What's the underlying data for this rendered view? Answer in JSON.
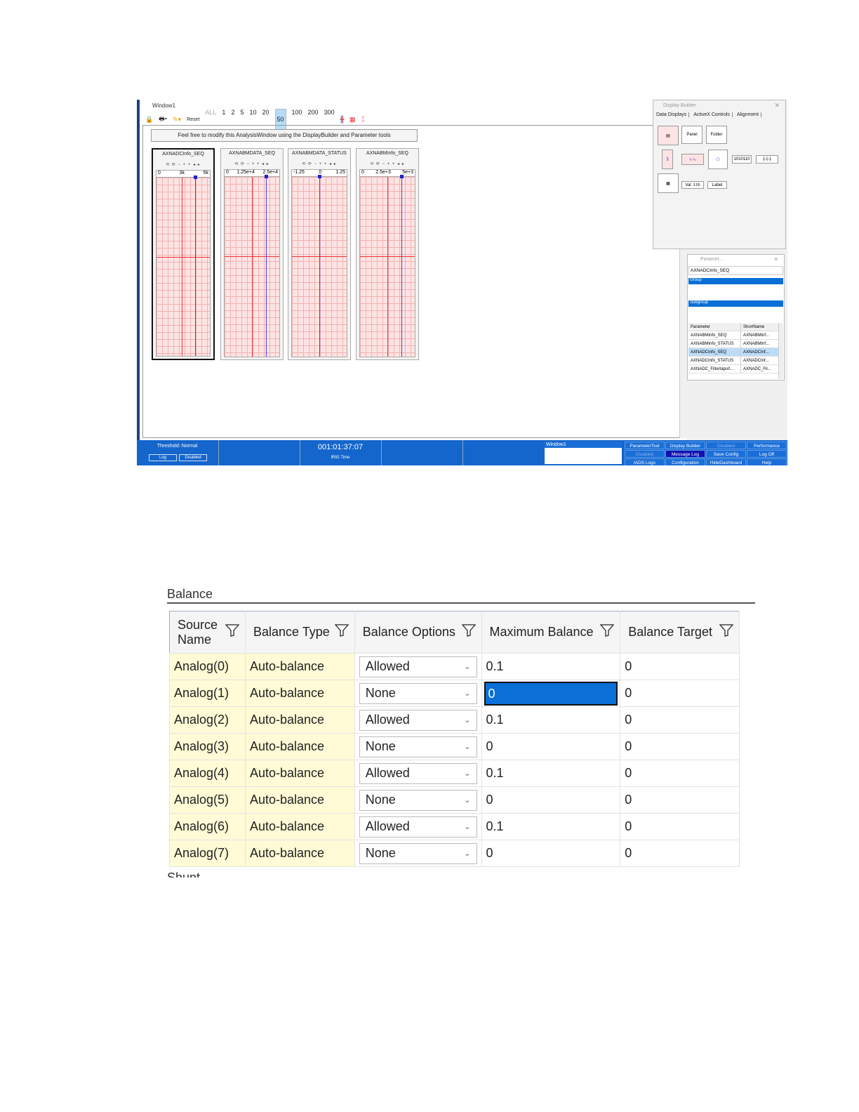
{
  "analysis_window": {
    "title": "Window1",
    "toolbar": {
      "reset": "Reset",
      "ranges": [
        "ALL",
        "1",
        "2",
        "5",
        "10",
        "20",
        "50",
        "100",
        "200",
        "300"
      ],
      "selected_range": "50"
    },
    "banner": "Feel free to modify this AnalysisWindow using the DisplayBuilder and Parameter tools",
    "strips": [
      {
        "name": "AXNADCInfo_SEQ",
        "ticks": [
          "0",
          "3k",
          "5k"
        ]
      },
      {
        "name": "AXNABMDATA_SEQ",
        "ticks": [
          "0",
          "1.25e+4",
          "2.5e+4"
        ]
      },
      {
        "name": "AXNABMDATA_STATUS",
        "ticks": [
          "-1.25",
          "0",
          "1.25"
        ]
      },
      {
        "name": "AXNABMInfo_SEQ",
        "ticks": [
          "0",
          "2.5e+3",
          "5e+3"
        ]
      }
    ],
    "strip_controls": "⟲ ⟳  − + +  ◂ ▸"
  },
  "display_builder": {
    "title": "Display Builder",
    "tabs": [
      "Data Displays",
      "ActiveX Controls",
      "Alignment"
    ],
    "items": {
      "panel": "Panel",
      "folder": "Folder",
      "bits": "1010110",
      "val": "Val",
      "val_num": "3.55",
      "label": "Label"
    }
  },
  "parameter_tool": {
    "title": "Paramet...",
    "search": "AXNADCInfo_SEQ",
    "group": "Group",
    "subgroup": "Subgroup",
    "columns": [
      "Parameter",
      "ShortName"
    ],
    "rows": [
      [
        "AXNABMInfo_SEQ",
        "AXNABMInf..."
      ],
      [
        "AXNABMInfo_STATUS",
        "AXNABMInf..."
      ],
      [
        "AXNADCInfo_SEQ",
        "AXNADCInf..."
      ],
      [
        "AXNADCInfo_STATUS",
        "AXNADCInf..."
      ],
      [
        "AXNADC_Filtertaps0...",
        "AXNADC_Fil..."
      ]
    ],
    "selected_row": 2
  },
  "status_bar": {
    "threshold": "Threshold: Normal",
    "log": "Log",
    "disabled": "Disabled",
    "time": "001:01:37:07",
    "time_label": "IRIG Time",
    "window_list": [
      "Window1"
    ],
    "dashboard": [
      "ParameterTool",
      "Display Builder",
      "Disabled",
      "Performance",
      "Disabled",
      "Message Log",
      "Save Config",
      "Log Off",
      "IADS Logs",
      "Configuration",
      "HideDashboard",
      "Help"
    ]
  },
  "balance": {
    "title": "Balance",
    "columns": [
      "Source Name",
      "Balance Type",
      "Balance Options",
      "Maximum Balance",
      "Balance Target"
    ],
    "rows": [
      [
        "Analog(0)",
        "Auto-balance",
        "Allowed",
        "0.1",
        "0"
      ],
      [
        "Analog(1)",
        "Auto-balance",
        "None",
        "0",
        "0"
      ],
      [
        "Analog(2)",
        "Auto-balance",
        "Allowed",
        "0.1",
        "0"
      ],
      [
        "Analog(3)",
        "Auto-balance",
        "None",
        "0",
        "0"
      ],
      [
        "Analog(4)",
        "Auto-balance",
        "Allowed",
        "0.1",
        "0"
      ],
      [
        "Analog(5)",
        "Auto-balance",
        "None",
        "0",
        "0"
      ],
      [
        "Analog(6)",
        "Auto-balance",
        "Allowed",
        "0.1",
        "0"
      ],
      [
        "Analog(7)",
        "Auto-balance",
        "None",
        "0",
        "0"
      ]
    ],
    "editing_cell": [
      1,
      3
    ]
  },
  "next_section": "Shunt",
  "colors": {
    "accent": "#0a6fd6",
    "status_bar": "#1566cc",
    "readonly_cell": "#fffbd6"
  }
}
